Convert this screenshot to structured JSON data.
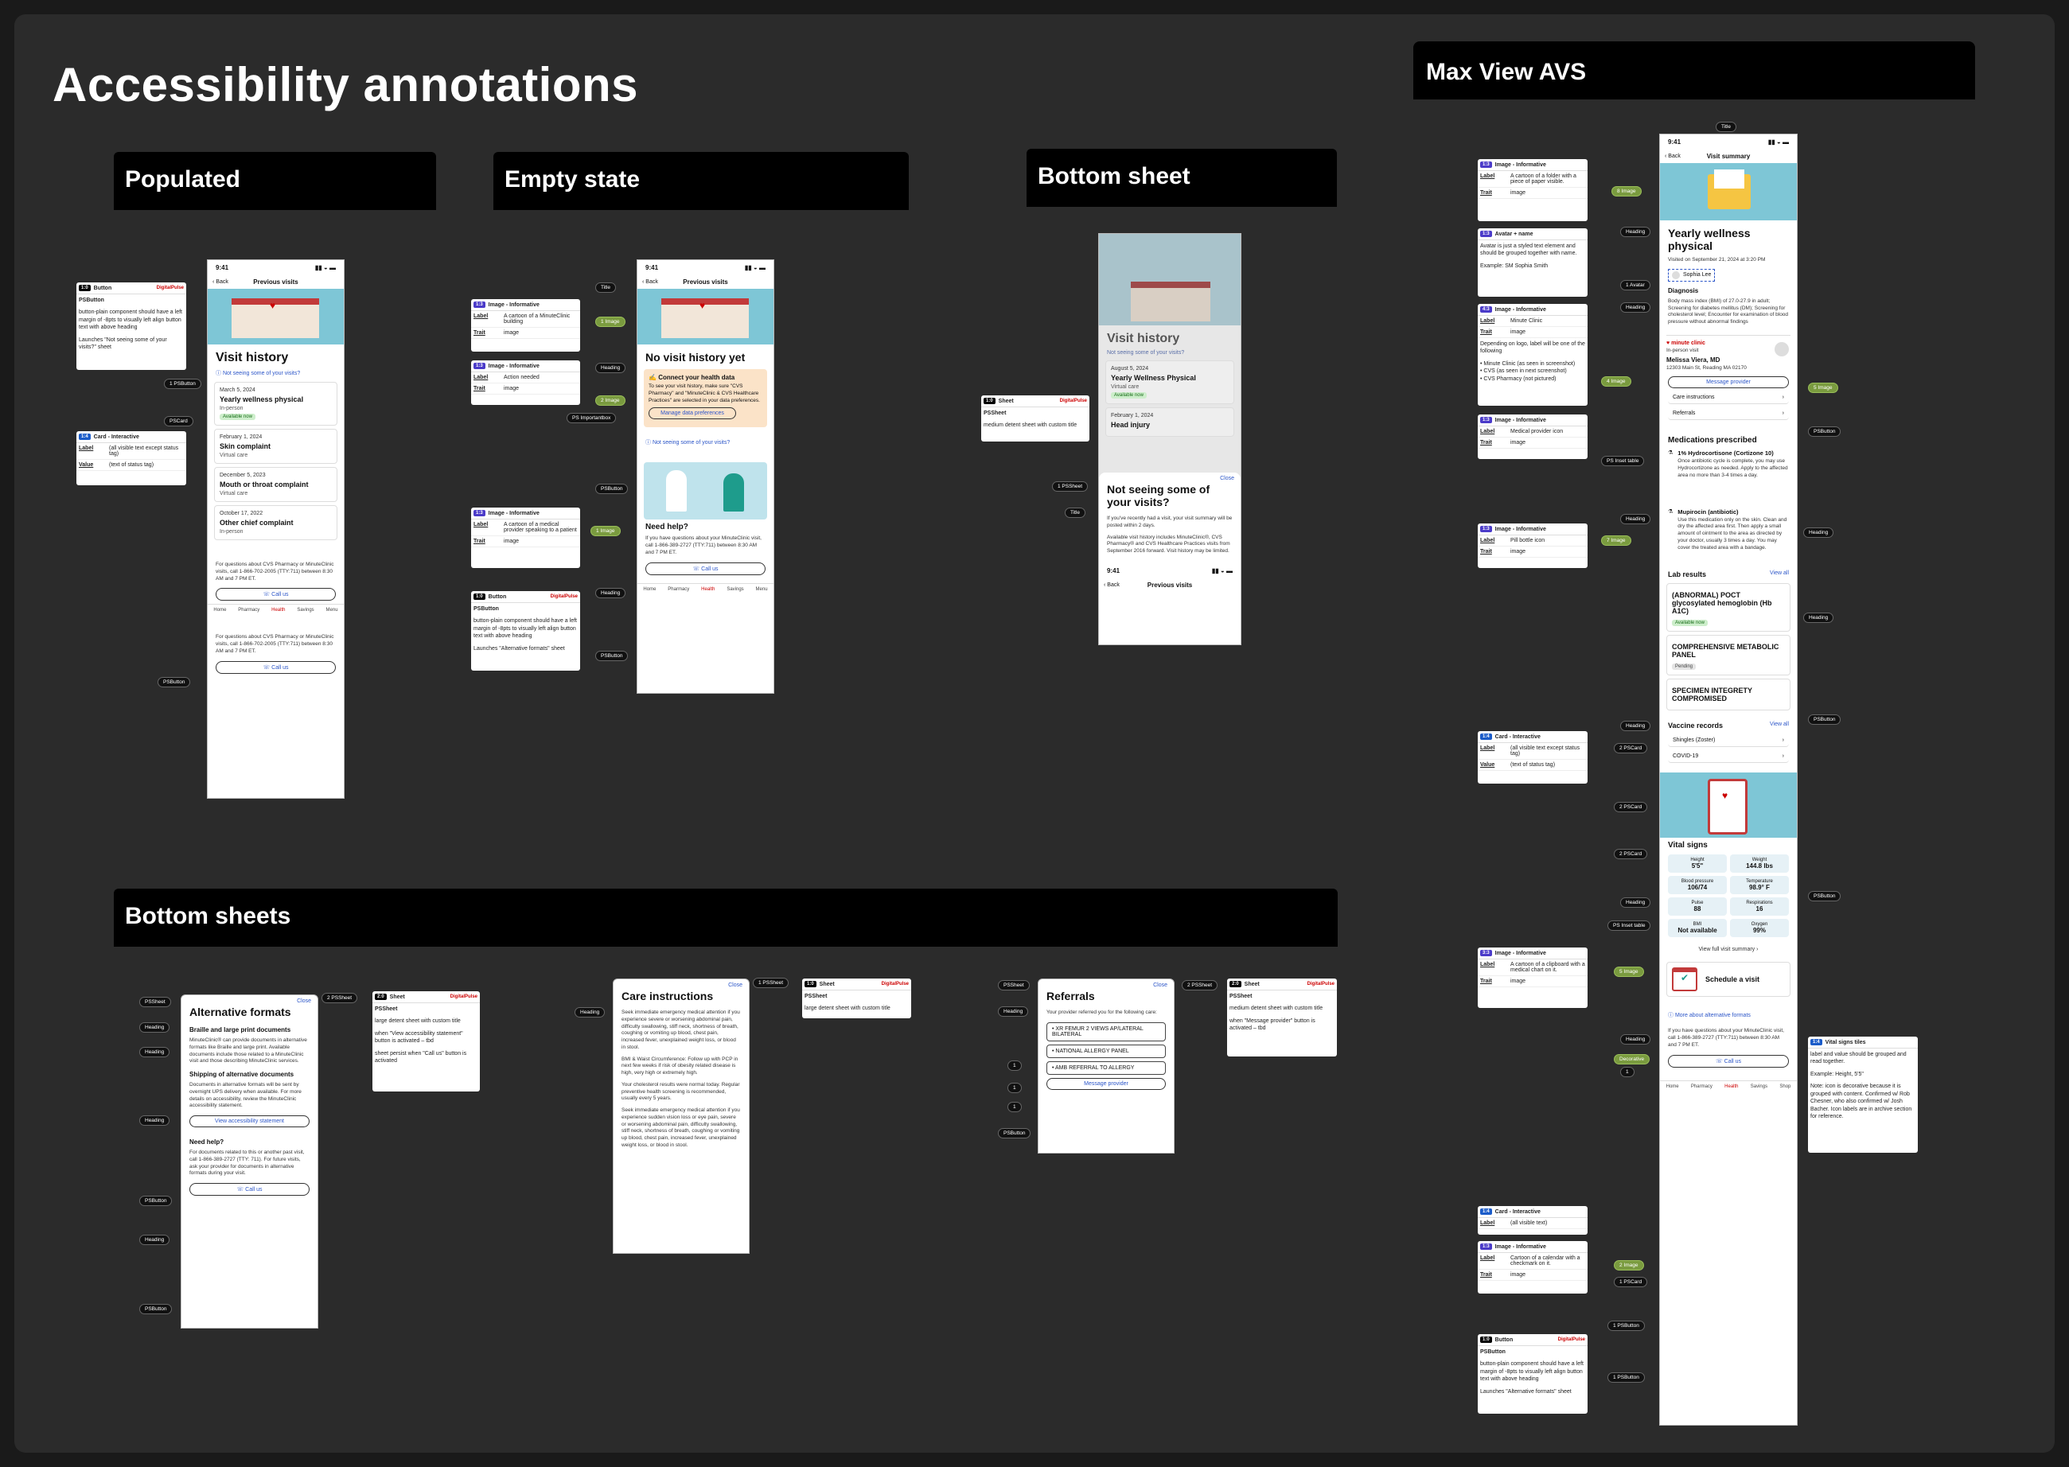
{
  "page": {
    "title": "Accessibility annotations"
  },
  "sections": {
    "populated": "Populated",
    "empty": "Empty state",
    "bottom_sheet": "Bottom sheet",
    "bottom_sheets": "Bottom sheets",
    "avs": "Max View AVS"
  },
  "common": {
    "time": "9:41",
    "back": "Back",
    "previous_visits": "Previous visits",
    "visit_history": "Visit history",
    "not_seeing": "Not seeing some of your visits?",
    "call_us": "Call us",
    "close": "Close",
    "tabs": [
      "Home",
      "Pharmacy",
      "Health",
      "Savings",
      "Menu"
    ],
    "footer_text": "For questions about CVS Pharmacy or MinuteClinic visits, call 1-866-702-2005 (TTY:711) between 8:30 AM and 7 PM ET."
  },
  "populated": {
    "visits": [
      {
        "date": "March 5, 2024",
        "title": "Yearly wellness physical",
        "type": "In-person",
        "tag": "Available now"
      },
      {
        "date": "February 1, 2024",
        "title": "Skin complaint",
        "type": "Virtual care"
      },
      {
        "date": "December 5, 2023",
        "title": "Mouth or throat complaint",
        "type": "Virtual care"
      },
      {
        "date": "October 17, 2022",
        "title": "Other chief complaint",
        "type": "In-person"
      }
    ],
    "anno_button": {
      "type": "Button",
      "brand": "DigitalPulse",
      "component": "PSButton",
      "body": "button-plain component should have a left margin of -8pts to visually left align button text with above heading",
      "launch": "Launches \"Not seeing some of your visits?\" sheet"
    },
    "anno_card": {
      "type": "Card - Interactive",
      "label_k": "Label",
      "label_v": "(all visible text except status tag)",
      "value_k": "Value",
      "value_v": "(text of status tag)"
    },
    "pills": {
      "b1": "1 PSButton",
      "card": "PSCard",
      "b2": "PSButton"
    }
  },
  "empty": {
    "no_history": "No visit history yet",
    "connect_title": "Connect your health data",
    "connect_body": "To see your visit history, make sure \"CVS Pharmacy\" and \"MinuteClinic & CVS Healthcare Practices\" are selected in your data preferences.",
    "manage": "Manage data preferences",
    "need_help": "Need help?",
    "help_body": "If you have questions about your MinuteClinic visit, call 1-866-389-2727 (TTY:711) between 8:30 AM and 7 PM ET.",
    "annos": [
      {
        "type": "Image - Informative",
        "label": "A cartoon of a MinuteClinic building",
        "trait": "image"
      },
      {
        "type": "Image - Informative",
        "label": "Action needed",
        "trait": "image"
      },
      {
        "type": "Image - Informative",
        "label": "A cartoon of a medical provider speaking to a patient",
        "trait": "image"
      }
    ],
    "anno_button": {
      "type": "Button",
      "brand": "DigitalPulse",
      "component": "PSButton",
      "body": "button-plain component should have a left margin of -8pts to visually left align button text with above heading",
      "launch": "Launches \"Alternative formats\" sheet"
    },
    "pills": [
      "Title",
      "1 Image",
      "Heading",
      "2 Image",
      "PS Importantbox",
      "PSButton",
      "1 Image",
      "Heading",
      "PSButton"
    ],
    "k_label": "Label",
    "k_trait": "Trait"
  },
  "bsheet": {
    "anno": {
      "type": "Sheet",
      "brand": "DigitalPulse",
      "component": "PSSheet",
      "body": "medium detent sheet with custom title"
    },
    "title": "Not seeing some of your visits?",
    "p1": "If you've recently had a visit, your visit summary will be posted within 2 days.",
    "p2": "Available visit history includes MinuteClinic®, CVS Pharmacy® and CVS Healthcare Practices visits from September 2016 forward. Visit history may be limited.",
    "bg_date": "August 5, 2024",
    "bg_title": "Yearly Wellness Physical",
    "bg_type": "Virtual care",
    "bg_tag": "Available now",
    "bg_date2": "February 1, 2024",
    "bg_title2": "Head injury",
    "pills": [
      "1 PSSheet",
      "Title"
    ]
  },
  "sheets": {
    "alt": {
      "title": "Alternative formats",
      "h1": "Braille and large print documents",
      "p1": "MinuteClinic® can provide documents in alternative formats like Braille and large print. Available documents include those related to a MinuteClinic visit and those describing MinuteClinic services.",
      "h2": "Shipping of alternative documents",
      "p2": "Documents in alternative formats will be sent by overnight UPS delivery when available. For more details on accessibility, review the MinuteClinic accessibility statement.",
      "btn": "View accessibility statement",
      "h3": "Need help?",
      "p3": "For documents related to this or another past visit, call 1-866-389-2727 (TTY: 711). For future visits, ask your provider for documents in alternative formats during your visit.",
      "anno": {
        "type": "Sheet",
        "brand": "DigitalPulse",
        "component": "PSSheet",
        "body": "large detent sheet with custom title",
        "b2": "when \"View accessibility statement\" button is activated – tbd",
        "b3": "sheet persist when \"Call us\" button is activated"
      },
      "pills": [
        "PSSheet",
        "Heading",
        "Heading",
        "Heading",
        "PSButton",
        "Heading",
        "PSButton",
        "2 PSSheet"
      ]
    },
    "care": {
      "title": "Care instructions",
      "p1": "Seek immediate emergency medical attention if you experience severe or worsening abdominal pain, difficulty swallowing, stiff neck, shortness of breath, coughing or vomiting up blood, chest pain, increased fever, unexplained weight loss, or blood in stool.",
      "p2": "BMI & Waist Circumference: Follow up with PCP in next few weeks if risk of obesity related disease is high, very high or extremely high.",
      "p3": "Your cholesterol results were normal today. Regular preventive health screening is recommended, usually every 5 years.",
      "p4": "Seek immediate emergency medical attention if you experience sudden vision loss or eye pain, severe or worsening abdominal pain, difficulty swallowing, stiff neck, shortness of breath, coughing or vomiting up blood, chest pain, increased fever, unexplained weight loss, or blood in stool.",
      "anno": {
        "type": "Sheet",
        "brand": "DigitalPulse",
        "component": "PSSheet",
        "body": "large detent sheet with custom title"
      },
      "pills": [
        "1 PSSheet",
        "Heading"
      ]
    },
    "ref": {
      "title": "Referrals",
      "p1": "Your provider referred you for the following care:",
      "items": [
        "XR FEMUR 2 VIEWS AP/LATERAL BILATERAL",
        "NATIONAL ALLERGY PANEL",
        "AMB REFERRAL TO ALLERGY"
      ],
      "btn": "Message provider",
      "anno": {
        "type": "Sheet",
        "brand": "DigitalPulse",
        "component": "PSSheet",
        "body": "medium detent sheet with custom title",
        "b2": "when \"Message provider\" button is activated – tbd"
      },
      "pills": [
        "PSSheet",
        "Heading",
        "1",
        "1",
        "1",
        "PSButton",
        "2 PSSheet"
      ]
    }
  },
  "avs": {
    "nav": "Visit summary",
    "title": "Yearly wellness physical",
    "visited": "Visited on September 21, 2024 at 3:20 PM",
    "patient": "Sophia Lee",
    "diagnosis_h": "Diagnosis",
    "diagnosis": "Body mass index (BMI) of 27.0-27.9 in adult; Screening for diabetes mellitus (DM); Screening for cholesterol level; Encounter for examination of blood pressure without abnormal findings",
    "clinic": "minute clinic",
    "visit_type": "In-person visit",
    "provider": "Melissa Viera, MD",
    "address": "12303 Main St, Reading MA 02170",
    "message": "Message provider",
    "links": [
      "Care instructions",
      "Referrals"
    ],
    "meds_h": "Medications prescribed",
    "meds": [
      {
        "name": "1% Hydrocortisone (Cortizone 10)",
        "body": "Once antibiotic cycle is complete, you may use Hydrocortizone as needed. Apply to the affected area no more than 3-4 times a day."
      },
      {
        "name": "Mupirocin (antibiotic)",
        "body": "Use this medication only on the skin. Clean and dry the affected area first. Then apply a small amount of ointment to the area as directed by your doctor, usually 3 times a day. You may cover the treated area with a bandage."
      }
    ],
    "lab_h": "Lab results",
    "view_all": "View all",
    "labs": [
      {
        "name": "(ABNORMAL) POCT glycosylated hemoglobin (Hb A1C)",
        "tag": "Available now"
      },
      {
        "name": "COMPREHENSIVE METABOLIC PANEL",
        "tag": "Pending"
      },
      {
        "name": "SPECIMEN INTEGRETY COMPROMISED"
      }
    ],
    "vaccine_h": "Vaccine records",
    "vaccines": [
      "Shingles (Zoster)",
      "COVID-19"
    ],
    "vitals_h": "Vital signs",
    "vitals": [
      {
        "k": "Height",
        "v": "5'5\""
      },
      {
        "k": "Weight",
        "v": "144.8 lbs"
      },
      {
        "k": "Blood pressure",
        "v": "106/74"
      },
      {
        "k": "Temperature",
        "v": "98.9° F"
      },
      {
        "k": "Pulse",
        "v": "88"
      },
      {
        "k": "Respirations",
        "v": "16"
      },
      {
        "k": "BMI",
        "v": "Not available"
      },
      {
        "k": "Oxygen",
        "v": "99%"
      }
    ],
    "full_summary": "View full visit summary",
    "schedule": "Schedule a visit",
    "alt_formats": "More about alternative formats",
    "footer": "If you have questions about your MinuteClinic visit, call 1-866-389-2727 (TTY:711) between 8:30 AM and 7 PM ET.",
    "tabs": [
      "Home",
      "Pharmacy",
      "Health",
      "Savings",
      "Shop"
    ],
    "annos": [
      {
        "type": "Image - Informative",
        "label": "A cartoon of a folder with a piece of paper visible.",
        "trait": "image"
      },
      {
        "type": "Avatar + name",
        "body": "Avatar is just a styled text element and should be grouped together with name.",
        "ex": "Example: SM Sophia Smith"
      },
      {
        "type": "Image - Informative",
        "label": "Minute Clinic",
        "trait": "image",
        "note": "Depending on logo, label will be one of the following",
        "opts": [
          "Minute Clinic (as seen in screenshot)",
          "CVS (as seen in next screenshot)",
          "CVS Pharmacy (not pictured)"
        ]
      },
      {
        "type": "Image - Informative",
        "label": "Medical provider icon",
        "trait": "image"
      },
      {
        "type": "Image - Informative",
        "label": "Pill bottle icon",
        "trait": "image"
      },
      {
        "type": "Card - Interactive",
        "label": "(all visible text except status tag)",
        "value": "(text of status tag)"
      },
      {
        "type": "Image - Informative",
        "label": "A cartoon of a clipboard with a medical chart on it.",
        "trait": "image"
      },
      {
        "type": "Card - Interactive",
        "label": "(all visible text)"
      },
      {
        "type": "Image - Informative",
        "label": "Cartoon of a calendar with a checkmark on it.",
        "trait": "image"
      }
    ],
    "anno_button": {
      "type": "Button",
      "brand": "DigitalPulse",
      "component": "PSButton",
      "body": "button-plain component should have a left margin of -8pts to visually left align button text with above heading",
      "launch": "Launches \"Alternative formats\" sheet"
    },
    "vital_anno": {
      "title": "Vital signs tiles",
      "b1": "label and value should be grouped and read together.",
      "b2": "Example: Height, 5'5\"",
      "b3": "Note: icon is decorative because it is grouped with content. Confirmed w/ Rob Chesner, who also confirmed w/ Josh Bacher. Icon labels are in archive section for reference."
    },
    "pills": [
      "Title",
      "8 Image",
      "Heading",
      "1 Avatar",
      "Heading",
      "4 Image",
      "5 Image",
      "PSButton",
      "PS Inset table",
      "Heading",
      "7 Image",
      "Heading",
      "Heading",
      "Heading",
      "2 PSCard",
      "2 PSCard",
      "2 PSCard",
      "PSButton",
      "Heading",
      "PS Inset table",
      "PSButton",
      "5 Image",
      "Heading",
      "Decorative",
      "1",
      "2 Image",
      "1 PSCard",
      "1 PSButton",
      "1 PSButton"
    ]
  }
}
